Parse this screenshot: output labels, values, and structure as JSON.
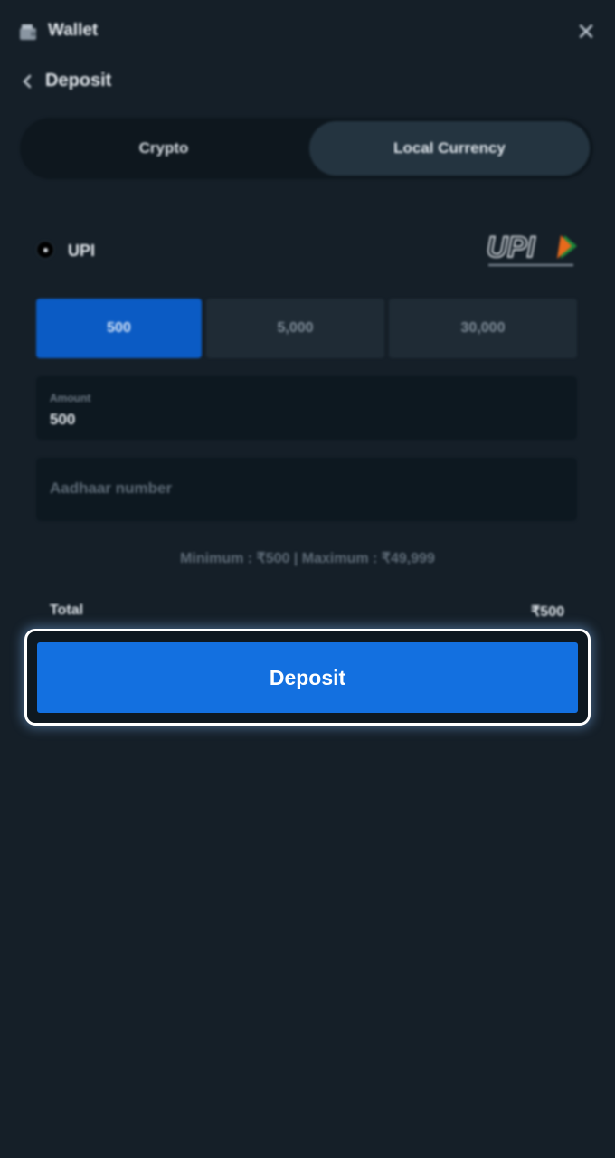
{
  "header": {
    "title": "Wallet",
    "close_icon": "close-icon"
  },
  "subheader": {
    "title": "Deposit"
  },
  "tabs": [
    {
      "label": "Crypto",
      "selected": false
    },
    {
      "label": "Local Currency",
      "selected": true
    }
  ],
  "payment_method": {
    "label": "UPI",
    "selected": true,
    "logo_text": "UPI"
  },
  "presets": [
    {
      "label": "500",
      "selected": true
    },
    {
      "label": "5,000",
      "selected": false
    },
    {
      "label": "30,000",
      "selected": false
    }
  ],
  "amount_field": {
    "label": "Amount",
    "value": "500"
  },
  "aadhaar_field": {
    "placeholder": "Aadhaar number",
    "value": ""
  },
  "limits": "Minimum : ₹500 | Maximum : ₹49,999",
  "total": {
    "label": "Total",
    "value": "₹500"
  },
  "deposit_button": {
    "label": "Deposit"
  },
  "colors": {
    "background": "#151f28",
    "accent": "#1370e0",
    "preset_selected": "#0b5bc4"
  }
}
